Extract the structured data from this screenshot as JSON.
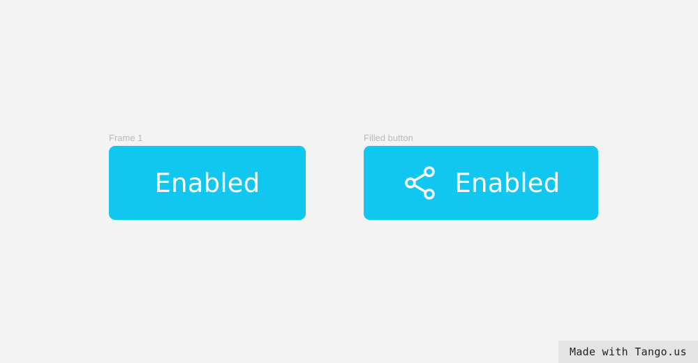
{
  "canvas": {
    "background": "#f3f3f3"
  },
  "frames": [
    {
      "label": "Frame 1",
      "button": {
        "label": "Enabled",
        "color": "#12c7ef",
        "icon": null
      }
    },
    {
      "label": "Filled button",
      "button": {
        "label": "Enabled",
        "color": "#12c7ef",
        "icon": "share-icon"
      }
    }
  ],
  "watermark": {
    "text": "Made with Tango.us"
  }
}
